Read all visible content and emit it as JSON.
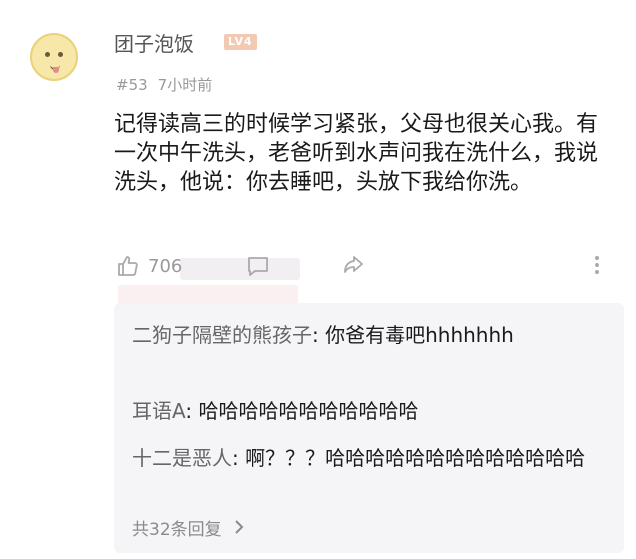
{
  "comment": {
    "username": "团子泡饭",
    "badge": "LV4",
    "floor": "#53",
    "time": "7小时前",
    "text": "记得读高三的时候学习紧张，父母也很关心我。有一次中午洗头，老爸听到水声问我在洗什么，我说洗头，他说：你去睡吧，头放下我给你洗。",
    "likes": "706"
  },
  "replies": [
    {
      "name": "二狗子隔壁的熊孩子",
      "sep": ": ",
      "text": "你爸有毒吧hhhhhhh"
    },
    {
      "name": "耳语A",
      "sep": ": ",
      "text": "哈哈哈哈哈哈哈哈哈哈哈"
    },
    {
      "name": "十二是恶人",
      "sep": ": ",
      "text": "啊？？？哈哈哈哈哈哈哈哈哈哈哈哈哈"
    }
  ],
  "more_replies": {
    "label": "共32条回复"
  },
  "icons": {
    "like": "thumbs-up-icon",
    "comment": "comment-icon",
    "share": "share-icon",
    "more": "more-vertical-icon",
    "chevron": "chevron-right-icon"
  },
  "colors": {
    "badge": "#f3c9b2",
    "reply_bg": "#f5f5f7",
    "muted": "#999999"
  }
}
